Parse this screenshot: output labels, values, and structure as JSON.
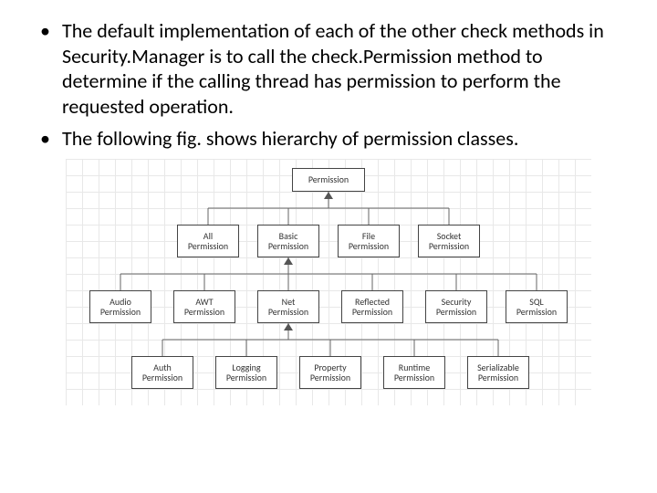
{
  "bullets": [
    "The default implementation of each of the other check methods in Security.Manager is to call the check.Permission method to determine if the calling thread has permission to perform the requested operation.",
    "The following fig. shows hierarchy of permission classes."
  ],
  "diagram": {
    "root": {
      "line1": "Permission"
    },
    "row2": [
      {
        "line1": "All",
        "line2": "Permission"
      },
      {
        "line1": "Basic",
        "line2": "Permission"
      },
      {
        "line1": "File",
        "line2": "Permission"
      },
      {
        "line1": "Socket",
        "line2": "Permission"
      }
    ],
    "row3": [
      {
        "line1": "Audio",
        "line2": "Permission"
      },
      {
        "line1": "AWT",
        "line2": "Permission"
      },
      {
        "line1": "Net",
        "line2": "Permission"
      },
      {
        "line1": "Reflected",
        "line2": "Permission"
      },
      {
        "line1": "Security",
        "line2": "Permission"
      },
      {
        "line1": "SQL",
        "line2": "Permission"
      }
    ],
    "row4": [
      {
        "line1": "Auth",
        "line2": "Permission"
      },
      {
        "line1": "Logging",
        "line2": "Permission"
      },
      {
        "line1": "Property",
        "line2": "Permission"
      },
      {
        "line1": "Runtime",
        "line2": "Permission"
      },
      {
        "line1": "Serializable",
        "line2": "Permission"
      }
    ]
  }
}
